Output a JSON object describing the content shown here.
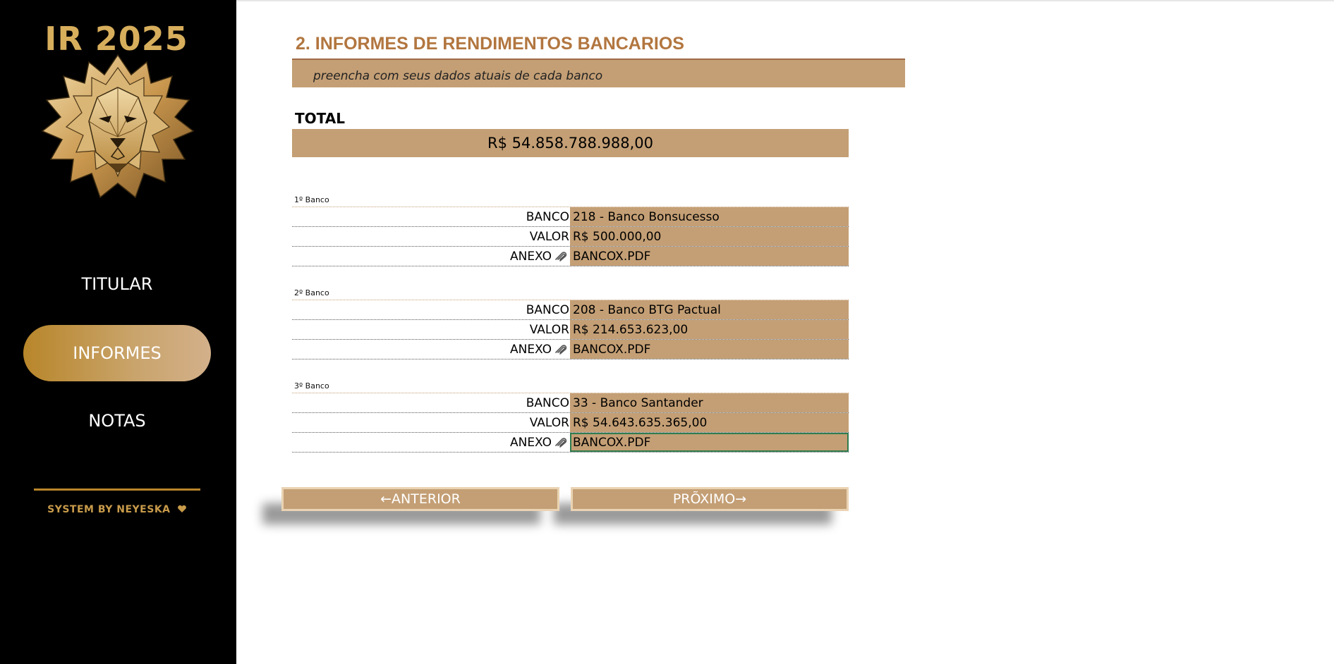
{
  "sidebar": {
    "app_title": "IR 2025",
    "nav": [
      {
        "label": "TITULAR",
        "active": false
      },
      {
        "label": "INFORMES",
        "active": true
      },
      {
        "label": "NOTAS",
        "active": false
      }
    ],
    "credit": "SYSTEM BY NEYESKA",
    "credit_icon": "heart-icon"
  },
  "main": {
    "section_title": "2. INFORMES DE RENDIMENTOS BANCARIOS",
    "subtitle": "preencha com seus dados atuais de cada banco",
    "total_label": "TOTAL",
    "total_value": "R$ 54.858.788.988,00",
    "banks": [
      {
        "heading": "1º Banco",
        "banco_label": "BANCO",
        "banco": "218 - Banco Bonsucesso",
        "valor_label": "VALOR",
        "valor": "R$ 500.000,00",
        "anexo_label": "ANEXO",
        "anexo": "BANCOX.PDF"
      },
      {
        "heading": "2º Banco",
        "banco_label": "BANCO",
        "banco": "208 - Banco BTG Pactual",
        "valor_label": "VALOR",
        "valor": "R$ 214.653.623,00",
        "anexo_label": "ANEXO",
        "anexo": "BANCOX.PDF"
      },
      {
        "heading": "3º Banco",
        "banco_label": "BANCO",
        "banco": "33 - Banco Santander",
        "valor_label": "VALOR",
        "valor": "R$ 54.643.635.365,00",
        "anexo_label": "ANEXO",
        "anexo": "BANCOX.PDF"
      }
    ],
    "buttons": {
      "previous": "←ANTERIOR",
      "next": "PRÕXIMO→"
    }
  },
  "colors": {
    "accent_tan": "#c49f75",
    "title_brown": "#b2763f",
    "gold": "#d7ae5c",
    "sidebar_bg": "#000000",
    "selection_green": "#2f7c4e"
  }
}
